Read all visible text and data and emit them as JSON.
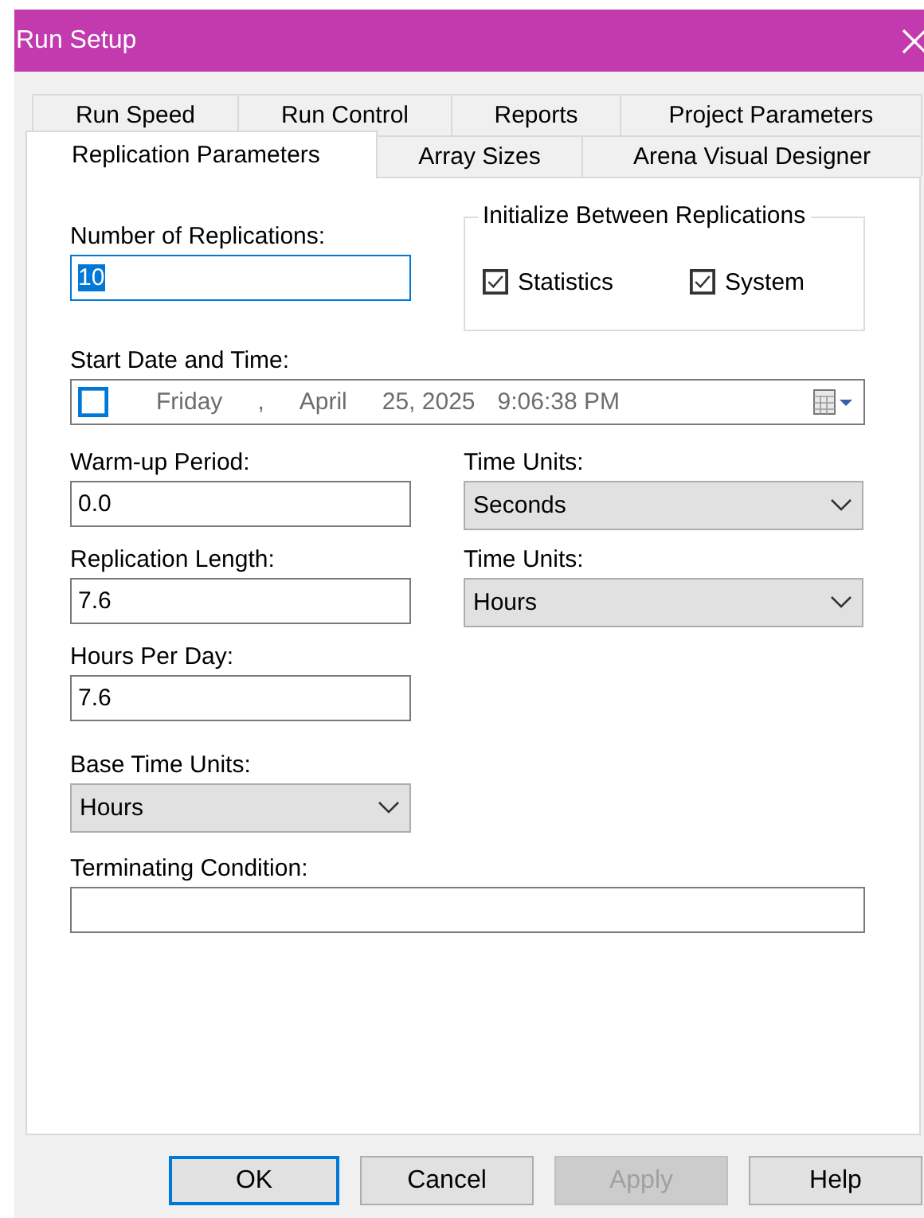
{
  "window": {
    "title": "Run Setup"
  },
  "tab_rows": [
    [
      {
        "label": "Run Speed",
        "selected": false
      },
      {
        "label": "Run Control",
        "selected": false
      },
      {
        "label": "Reports",
        "selected": false
      },
      {
        "label": "Project Parameters",
        "selected": false
      }
    ],
    [
      {
        "label": "Replication Parameters",
        "selected": true
      },
      {
        "label": "Array Sizes",
        "selected": false
      },
      {
        "label": "Arena Visual Designer",
        "selected": false
      }
    ]
  ],
  "replications": {
    "label": "Number of Replications:",
    "value": "10",
    "text_selected": true
  },
  "initialize": {
    "title": "Initialize Between Replications",
    "options": [
      {
        "label": "Statistics",
        "checked": true
      },
      {
        "label": "System",
        "checked": true
      }
    ]
  },
  "start_date": {
    "label": "Start Date and Time:",
    "checked": false,
    "day": "Friday",
    "separator": ",",
    "month": "April",
    "date": "25, 2025",
    "time": "9:06:38 PM"
  },
  "warm_up": {
    "label": "Warm-up Period:",
    "value": "0.0"
  },
  "warm_up_units": {
    "label": "Time Units:",
    "value": "Seconds"
  },
  "replication_length": {
    "label": "Replication Length:",
    "value": "7.6"
  },
  "length_units": {
    "label": "Time Units:",
    "value": "Hours"
  },
  "hours_per_day": {
    "label": "Hours Per Day:",
    "value": "7.6"
  },
  "base_time_units": {
    "label": "Base Time Units:",
    "value": "Hours"
  },
  "terminating_condition": {
    "label": "Terminating Condition:"
  },
  "buttons": [
    {
      "label": "OK",
      "default": true,
      "disabled": false
    },
    {
      "label": "Cancel",
      "default": false,
      "disabled": false
    },
    {
      "label": "Apply",
      "default": false,
      "disabled": true
    },
    {
      "label": "Help",
      "default": false,
      "disabled": false
    }
  ]
}
